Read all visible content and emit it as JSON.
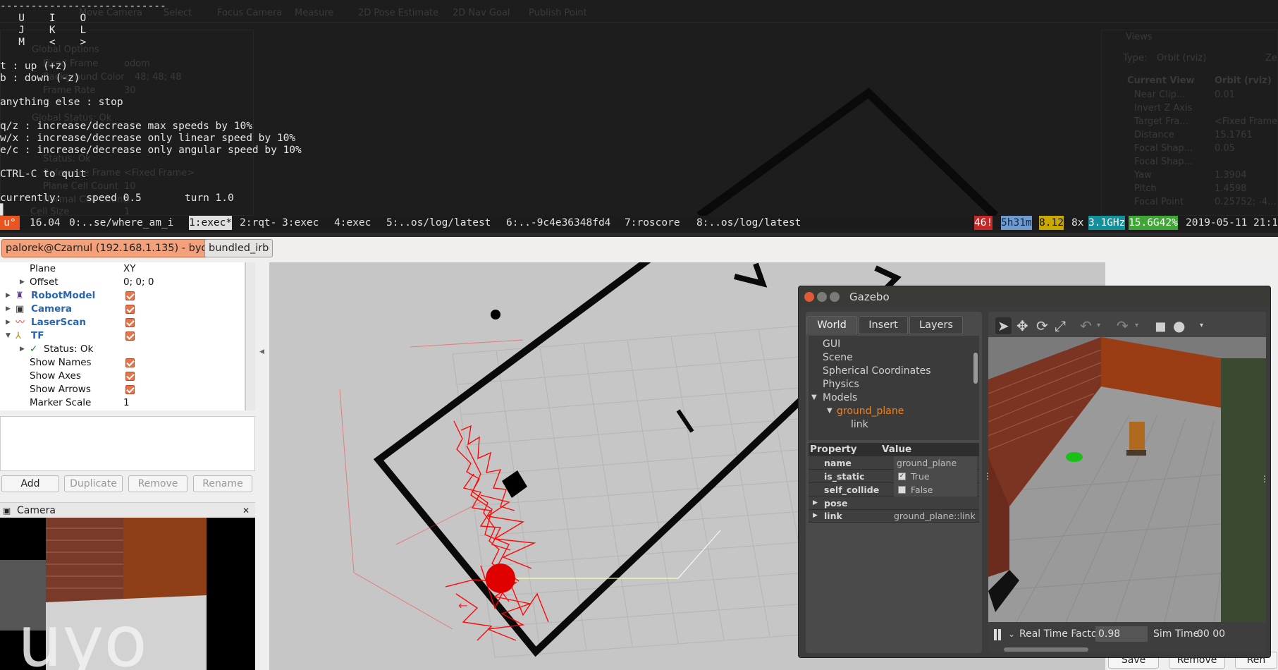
{
  "terminal": {
    "ghost_toolbar": [
      "Move Camera",
      "Select",
      "Focus Camera",
      "Measure",
      "2D Pose Estimate",
      "2D Nav Goal",
      "Publish Point"
    ],
    "ghost_left": [
      "Global Options",
      "Fixed Frame",
      "odom",
      "Background Color",
      "48; 48; 48",
      "Frame Rate",
      "30",
      "Global Status: Ok",
      "Status: Ok",
      "Reference Frame",
      "<Fixed Frame>",
      "Plane Cell Count",
      "10",
      "Normal Cell Count",
      "0",
      "Cell Size",
      "1"
    ],
    "ghost_right": {
      "title": "Views",
      "type_label": "Type:",
      "type_value": "Orbit (rviz)",
      "zero_label": "Ze",
      "current_view": "Current View",
      "current_view_value": "Orbit (rviz)",
      "props": [
        [
          "Near Clip...",
          "0.01"
        ],
        [
          "Invert Z Axis",
          ""
        ],
        [
          "Target Fra...",
          "<Fixed Frame>"
        ],
        [
          "Distance",
          "15.1761"
        ],
        [
          "Focal Shap...",
          "0.05"
        ],
        [
          "Focal Shap...",
          ""
        ],
        [
          "Yaw",
          "1.3904"
        ],
        [
          "Pitch",
          "1.4598"
        ],
        [
          "Focal Point",
          "0.25752; -4..."
        ]
      ]
    },
    "lines": [
      "---------------------------",
      "   U    I    O",
      "   J    K    L",
      "   M    <    >",
      "",
      "t : up (+z)",
      "b : down (-z)",
      "",
      "anything else : stop",
      "",
      "q/z : increase/decrease max speeds by 10%",
      "w/x : increase/decrease only linear speed by 10%",
      "e/c : increase/decrease only angular speed by 10%",
      "",
      "CTRL-C to quit",
      "",
      "currently:    speed 0.5       turn 1.0"
    ],
    "cursor": "▌"
  },
  "byobu": {
    "logo": "u°",
    "release": "16.04",
    "windows": [
      "0:..se/where_am_i",
      "1:exec*",
      "2:rqt-",
      "3:exec",
      "4:exec",
      "5:..os/log/latest",
      "6:..-9c4e36348fd4",
      "7:roscore",
      "8:..os/log/latest"
    ],
    "updates": "46!",
    "uptime": "5h31m",
    "load": "8.12",
    "cpu_count": "8x",
    "cpu_freq": "3.1GHz",
    "mem": "15.6G42%",
    "datetime": "2019-05-11 21:1"
  },
  "tabs": [
    "palorek@Czarnul (192.168.1.135) - byobu",
    "bundled_irb"
  ],
  "rviz_displays": {
    "rows": [
      {
        "label": "Plane",
        "value": "XY"
      },
      {
        "label": "Offset",
        "value": "0; 0; 0"
      },
      {
        "label": "RobotModel",
        "value": ""
      },
      {
        "label": "Camera",
        "value": ""
      },
      {
        "label": "LaserScan",
        "value": ""
      },
      {
        "label": "TF",
        "value": ""
      },
      {
        "label": "Status: Ok",
        "value": ""
      },
      {
        "label": "Show Names",
        "value": ""
      },
      {
        "label": "Show Axes",
        "value": ""
      },
      {
        "label": "Show Arrows",
        "value": ""
      },
      {
        "label": "Marker Scale",
        "value": "1"
      }
    ],
    "buttons": [
      "Add",
      "Duplicate",
      "Remove",
      "Rename"
    ],
    "camera_panel_title": "Camera",
    "camera_text": "uyo"
  },
  "right_panel": {
    "buttons": [
      "Save",
      "Remove",
      "Ren"
    ]
  },
  "gazebo": {
    "title": "Gazebo",
    "tabs": [
      "World",
      "Insert",
      "Layers"
    ],
    "tree": [
      "GUI",
      "Scene",
      "Spherical Coordinates",
      "Physics",
      "Models",
      "ground_plane",
      "link"
    ],
    "prop_header": [
      "Property",
      "Value"
    ],
    "props": [
      {
        "k": "name",
        "v": "ground_plane"
      },
      {
        "k": "is_static",
        "v": "True"
      },
      {
        "k": "self_collide",
        "v": "False"
      },
      {
        "k": "pose",
        "v": ""
      },
      {
        "k": "link",
        "v": "ground_plane::link"
      }
    ],
    "rtf_label": "Real Time Factor:",
    "rtf_value": "0.98",
    "simtime_label": "Sim Time:",
    "simtime_value": "00 00"
  }
}
